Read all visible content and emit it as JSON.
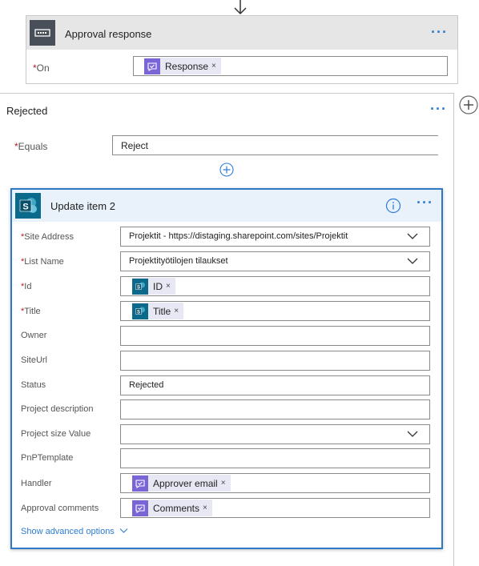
{
  "approval_card": {
    "title": "Approval response",
    "more_label": "···",
    "on_label": "On",
    "on_token": "Response"
  },
  "rejected": {
    "title": "Rejected",
    "more_label": "···",
    "equals_label": "Equals",
    "equals_value": "Reject"
  },
  "update_card": {
    "title": "Update item 2",
    "more_label": "···",
    "fields": {
      "site_address": {
        "label": "Site Address",
        "value": "Projektit - https://distaging.sharepoint.com/sites/Projektit"
      },
      "list_name": {
        "label": "List Name",
        "value": "Projektityötilojen tilaukset"
      },
      "id": {
        "label": "Id",
        "token": "ID"
      },
      "title": {
        "label": "Title",
        "token": "Title"
      },
      "owner": {
        "label": "Owner",
        "value": ""
      },
      "siteurl": {
        "label": "SiteUrl",
        "value": ""
      },
      "status": {
        "label": "Status",
        "value": "Rejected"
      },
      "project_description": {
        "label": "Project description",
        "value": ""
      },
      "project_size": {
        "label": "Project size Value",
        "value": ""
      },
      "pnp_template": {
        "label": "PnPTemplate",
        "value": ""
      },
      "handler": {
        "label": "Handler",
        "token": "Approver email"
      },
      "approval_comments": {
        "label": "Approval comments",
        "token": "Comments"
      }
    },
    "advanced_link": "Show advanced options"
  },
  "required_marker": "*",
  "token_remove": "×",
  "colors": {
    "accent": "#2b7cd3",
    "card_border": "#2f78c4",
    "approval_icon_bg": "#484f58",
    "sharepoint": "#0b6a8c",
    "approval_token": "#7b65d6",
    "required": "#b4202a"
  },
  "icons": [
    "down-arrow-icon",
    "keyboard-icon",
    "approval-icon",
    "sharepoint-icon",
    "info-icon",
    "add-icon",
    "chevron-down-icon"
  ]
}
